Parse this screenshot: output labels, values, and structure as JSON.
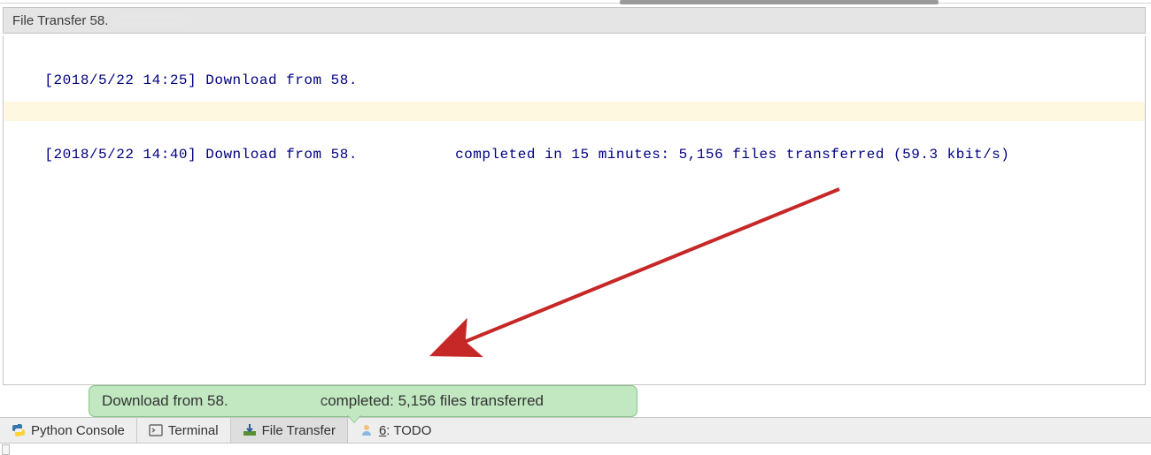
{
  "panel": {
    "title_prefix": "File Transfer 58."
  },
  "log": {
    "line1_a": "[2018/5/22 14:25] Download from 58.",
    "line2_a": "[2018/5/22 14:40] Download from 58.",
    "line2_b": " completed in 15 minutes: 5,156 files transferred (59.3 kbit/s)"
  },
  "toast": {
    "label_a": "Download from 58.",
    "label_b": " completed: 5,156 files transferred"
  },
  "tabs": {
    "python_console": "Python Console",
    "terminal": "Terminal",
    "file_transfer": "File Transfer",
    "todo_underline": "6",
    "todo_rest": ": TODO"
  }
}
